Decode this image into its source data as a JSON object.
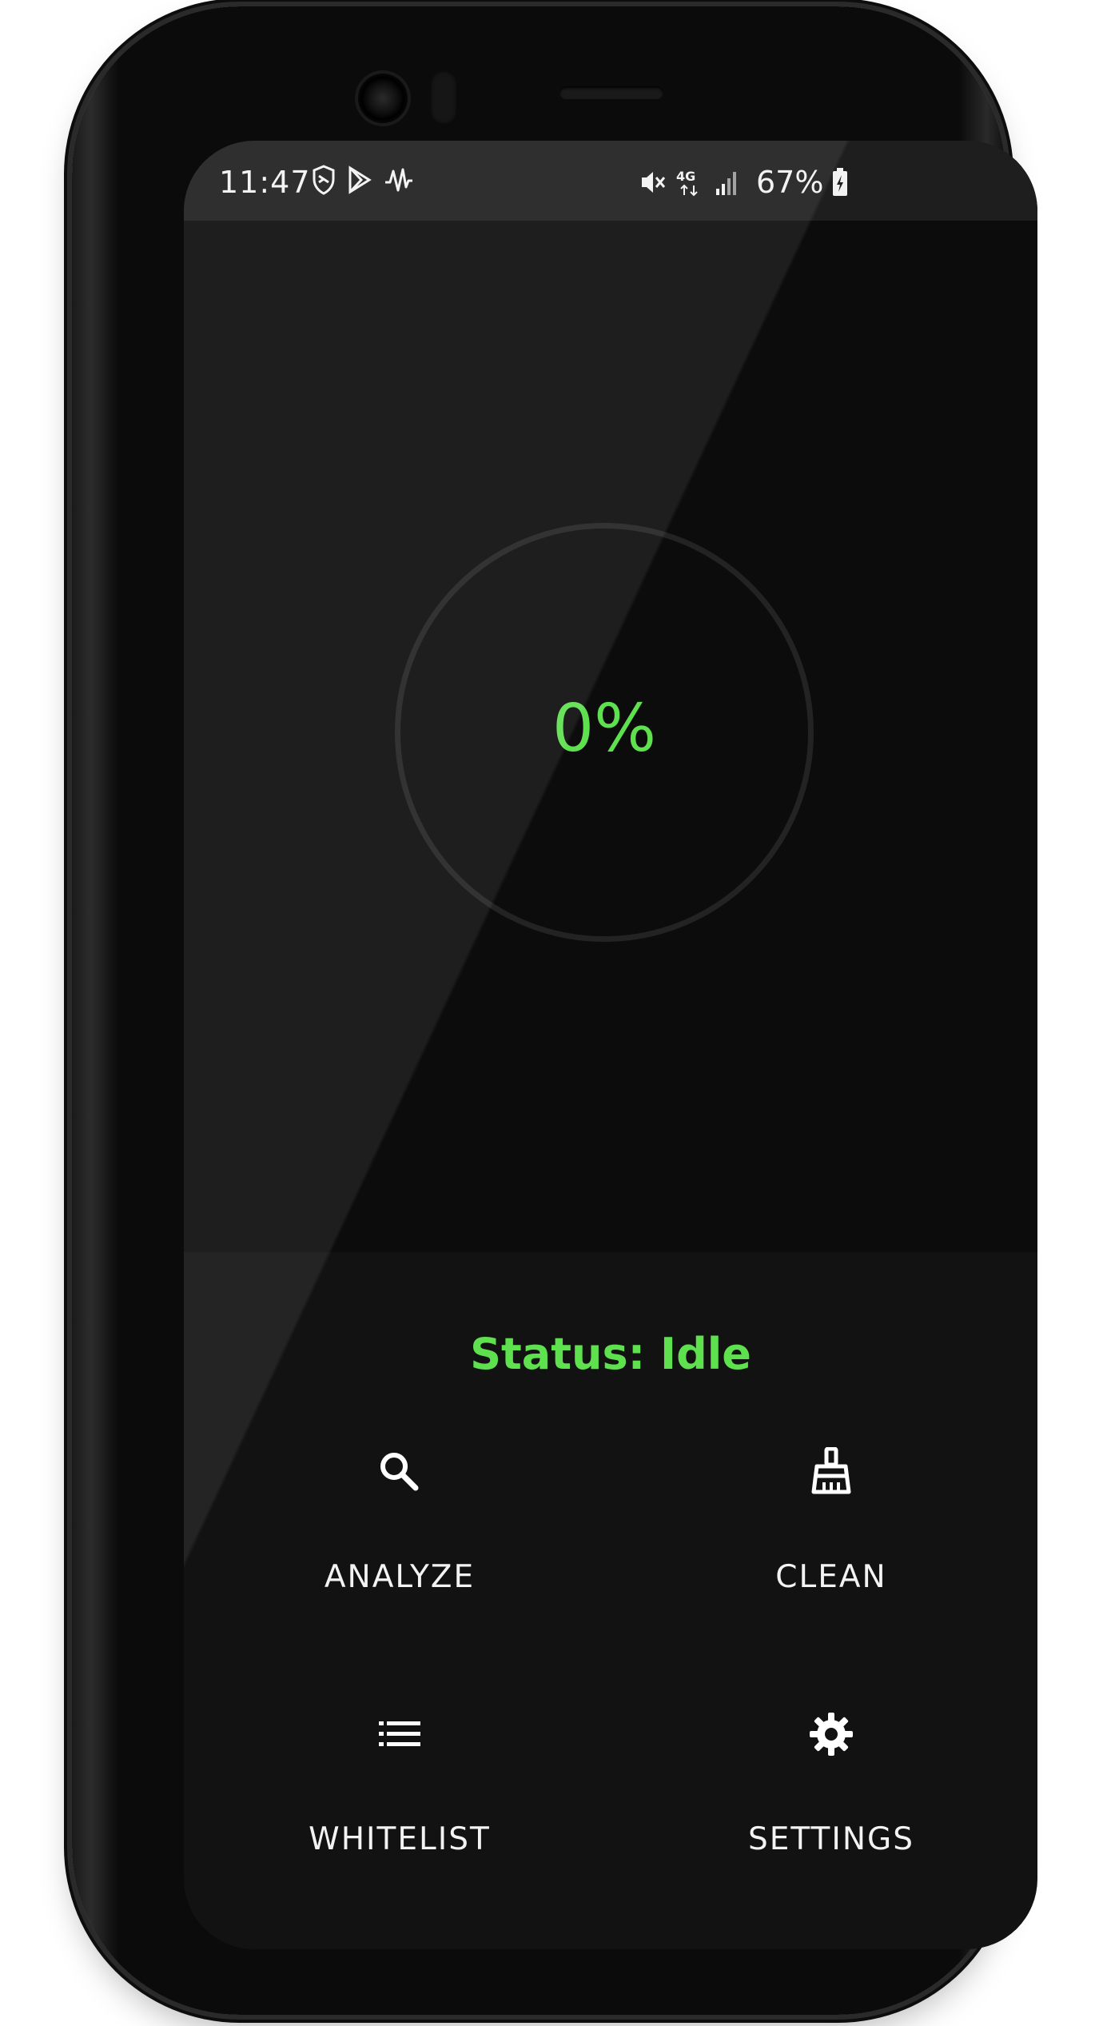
{
  "status_bar": {
    "time": "11:47",
    "battery": "67%",
    "left_icons": [
      "shield-icon",
      "play-store-icon",
      "pulse-icon"
    ],
    "right_icons": [
      "mute-icon",
      "network-4g-icon",
      "signal-icon",
      "battery-charging-icon"
    ]
  },
  "gauge": {
    "percent": "0%",
    "progress_fraction": 0,
    "accent_color": "#5ee04f"
  },
  "status": {
    "text": "Status: Idle"
  },
  "actions": [
    {
      "label": "ANALYZE",
      "icon": "search-icon"
    },
    {
      "label": "CLEAN",
      "icon": "broom-icon"
    },
    {
      "label": "WHITELIST",
      "icon": "list-icon"
    },
    {
      "label": "SETTINGS",
      "icon": "gear-icon"
    }
  ],
  "theme": {
    "background": "#121212",
    "panel": "#0c0c0c",
    "status_bar": "#1e1e1e",
    "text": "#f3f3f3"
  }
}
